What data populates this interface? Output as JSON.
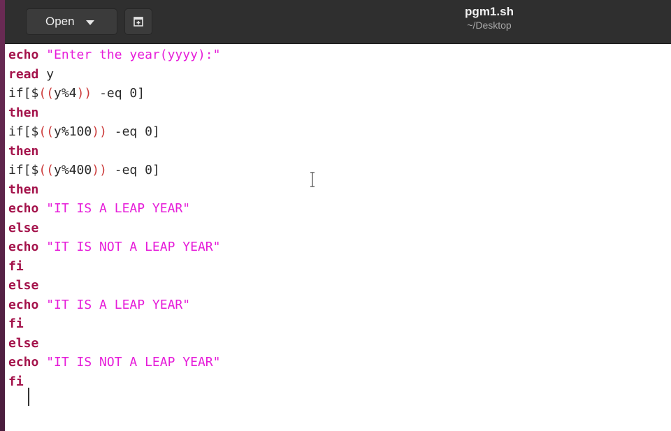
{
  "header": {
    "open_label": "Open",
    "title": "pgm1.sh",
    "path": "~/Desktop",
    "icons": [
      "chevron-down-icon",
      "new-tab-icon"
    ]
  },
  "editor": {
    "lines": [
      [
        {
          "t": "echo",
          "c": "kw"
        },
        {
          "t": " ",
          "c": "plain"
        },
        {
          "t": "\"Enter the year(yyyy):\"",
          "c": "str"
        }
      ],
      [
        {
          "t": "read",
          "c": "kw"
        },
        {
          "t": " y",
          "c": "plain"
        }
      ],
      [
        {
          "t": "if[$",
          "c": "plain"
        },
        {
          "t": "((",
          "c": "paren"
        },
        {
          "t": "y%4",
          "c": "plain"
        },
        {
          "t": "))",
          "c": "paren"
        },
        {
          "t": " -eq 0]",
          "c": "plain"
        }
      ],
      [
        {
          "t": "then",
          "c": "kw"
        }
      ],
      [
        {
          "t": "if[$",
          "c": "plain"
        },
        {
          "t": "((",
          "c": "paren"
        },
        {
          "t": "y%100",
          "c": "plain"
        },
        {
          "t": "))",
          "c": "paren"
        },
        {
          "t": " -eq 0]",
          "c": "plain"
        }
      ],
      [
        {
          "t": "then",
          "c": "kw"
        }
      ],
      [
        {
          "t": "if[$",
          "c": "plain"
        },
        {
          "t": "((",
          "c": "paren"
        },
        {
          "t": "y%400",
          "c": "plain"
        },
        {
          "t": "))",
          "c": "paren"
        },
        {
          "t": " -eq 0]",
          "c": "plain"
        }
      ],
      [
        {
          "t": "then",
          "c": "kw"
        }
      ],
      [
        {
          "t": "echo",
          "c": "kw"
        },
        {
          "t": " ",
          "c": "plain"
        },
        {
          "t": "\"IT IS A LEAP YEAR\"",
          "c": "str"
        }
      ],
      [
        {
          "t": "else",
          "c": "kw"
        }
      ],
      [
        {
          "t": "echo",
          "c": "kw"
        },
        {
          "t": " ",
          "c": "plain"
        },
        {
          "t": "\"IT IS NOT A LEAP YEAR\"",
          "c": "str"
        }
      ],
      [
        {
          "t": "fi",
          "c": "kw"
        }
      ],
      [
        {
          "t": "else",
          "c": "kw"
        }
      ],
      [
        {
          "t": "echo",
          "c": "kw"
        },
        {
          "t": " ",
          "c": "plain"
        },
        {
          "t": "\"IT IS A LEAP YEAR\"",
          "c": "str"
        }
      ],
      [
        {
          "t": "fi",
          "c": "kw"
        }
      ],
      [
        {
          "t": "else",
          "c": "kw"
        }
      ],
      [
        {
          "t": "echo",
          "c": "kw"
        },
        {
          "t": " ",
          "c": "plain"
        },
        {
          "t": "\"IT IS NOT A LEAP YEAR\"",
          "c": "str"
        }
      ],
      [
        {
          "t": "fi",
          "c": "kw"
        }
      ]
    ]
  },
  "colors": {
    "keyword": "#a4134b",
    "string": "#e61cd9",
    "paren": "#cc3b3b",
    "header_bg": "#2f2f2f"
  }
}
